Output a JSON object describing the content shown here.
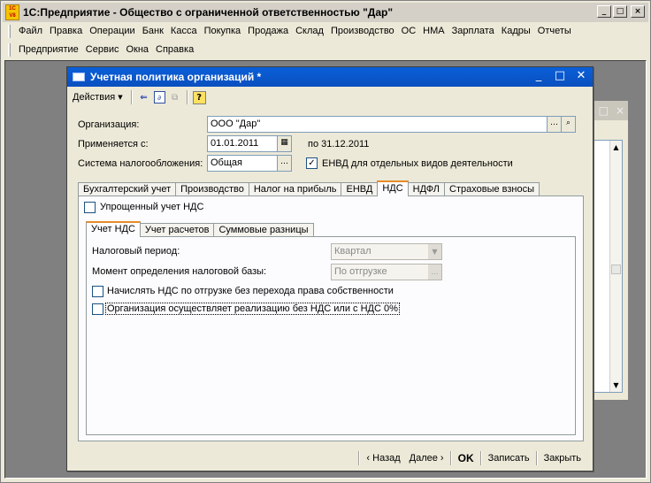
{
  "app": {
    "title": "1С:Предприятие - Общество с ограниченной ответственностью \"Дар\"",
    "logo_text_top": "1С",
    "logo_text_bottom": "V8"
  },
  "menubar": {
    "row1": [
      "Файл",
      "Правка",
      "Операции",
      "Банк",
      "Касса",
      "Покупка",
      "Продажа",
      "Склад",
      "Производство",
      "ОС",
      "НМА",
      "Зарплата",
      "Кадры",
      "Отчеты"
    ],
    "row2": [
      "Предприятие",
      "Сервис",
      "Окна",
      "Справка"
    ]
  },
  "dialog": {
    "title": "Учетная политика организаций *",
    "toolbar": {
      "actions_label": "Действия"
    },
    "fields": {
      "organization_label": "Организация:",
      "organization_value": "ООО \"Дар\"",
      "applies_label": "Применяется с:",
      "applies_value": "01.01.2011",
      "applies_to": "по 31.12.2011",
      "tax_system_label": "Система налогообложения:",
      "tax_system_value": "Общая",
      "envd_label": "ЕНВД для отдельных видов деятельности",
      "envd_checked": true
    },
    "tabs": [
      "Бухгалтерский учет",
      "Производство",
      "Налог на прибыль",
      "ЕНВД",
      "НДС",
      "НДФЛ",
      "Страховые взносы"
    ],
    "active_tab": "НДС",
    "nds": {
      "simplified_label": "Упрощенный учет НДС",
      "subtabs": [
        "Учет НДС",
        "Учет расчетов",
        "Суммовые разницы"
      ],
      "tax_period_label": "Налоговый период:",
      "tax_period_value": "Квартал",
      "moment_label": "Момент определения налоговой базы:",
      "moment_value": "По отгрузке",
      "accrue_label": "Начислять НДС по отгрузке без перехода права собственности",
      "no_vat_label": "Организация осуществляет реализацию без НДС или с НДС 0%"
    },
    "footer": {
      "back": "‹ Назад",
      "next": "Далее ›",
      "ok": "OK",
      "save": "Записать",
      "close": "Закрыть"
    }
  }
}
